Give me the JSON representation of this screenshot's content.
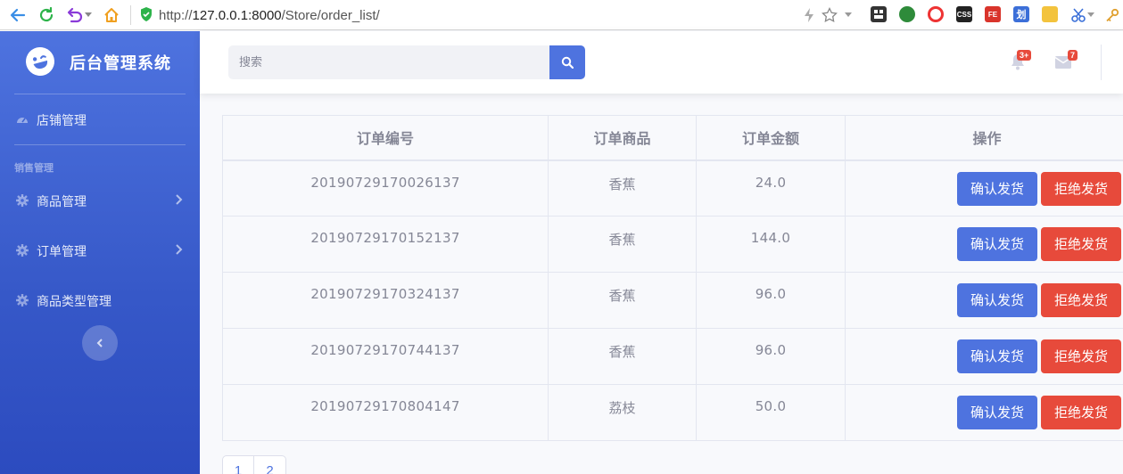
{
  "browser": {
    "url_prefix": "http://",
    "url_host": "127.0.0.1:8000",
    "url_path": "/Store/order_list/",
    "extensions": [
      "CSS",
      "FE",
      "划"
    ]
  },
  "sidebar": {
    "brand": "后台管理系统",
    "items": [
      {
        "label": "店铺管理",
        "icon": "tachometer-icon"
      },
      {
        "label": "商品管理",
        "icon": "cog-icon"
      },
      {
        "label": "订单管理",
        "icon": "cog-icon"
      },
      {
        "label": "商品类型管理",
        "icon": "cog-icon"
      }
    ],
    "heading": "销售管理"
  },
  "topbar": {
    "search_placeholder": "搜索",
    "alerts_badge": "3+",
    "messages_badge": "7"
  },
  "table": {
    "headers": [
      "订单编号",
      "订单商品",
      "订单金额",
      "操作"
    ],
    "rows": [
      {
        "order_no": "20190729170026137",
        "product": "香蕉",
        "amount": "24.0"
      },
      {
        "order_no": "20190729170152137",
        "product": "香蕉",
        "amount": "144.0"
      },
      {
        "order_no": "20190729170324137",
        "product": "香蕉",
        "amount": "96.0"
      },
      {
        "order_no": "20190729170744137",
        "product": "香蕉",
        "amount": "96.0"
      },
      {
        "order_no": "20190729170804147",
        "product": "荔枝",
        "amount": "50.0"
      }
    ],
    "confirm_label": "确认发货",
    "reject_label": "拒绝发货"
  },
  "pagination": [
    "1",
    "2"
  ],
  "colors": {
    "primary": "#4e73df",
    "danger": "#e74a3b",
    "text": "#858796"
  }
}
